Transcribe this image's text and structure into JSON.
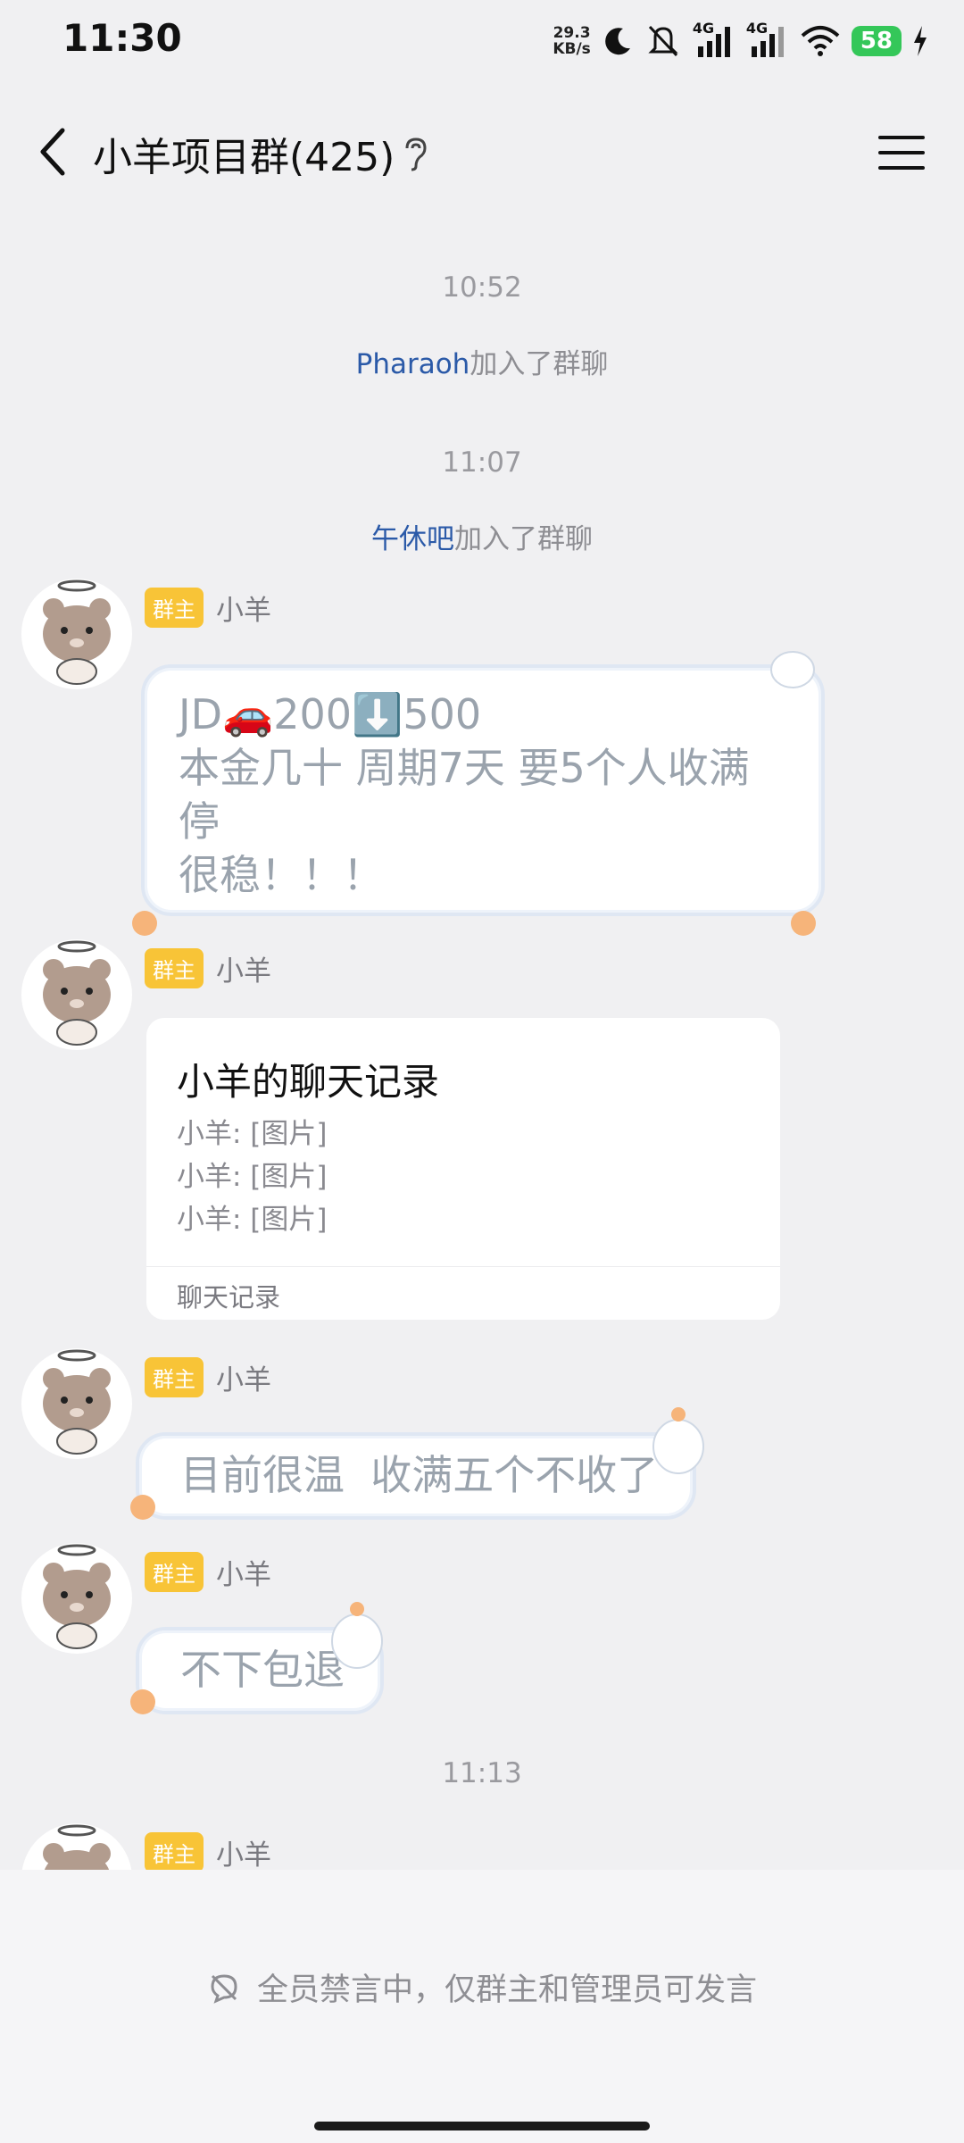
{
  "status_bar": {
    "time": "11:30",
    "net_speed_value": "29.3",
    "net_speed_unit": "KB/s",
    "signal_1": "4G",
    "signal_2": "4G",
    "battery": "58"
  },
  "header": {
    "title": "小羊项目群(425)"
  },
  "timestamps": [
    "10:52",
    "11:07",
    "11:13"
  ],
  "system_notices": [
    {
      "name": "Pharaoh",
      "text": "加入了群聊"
    },
    {
      "name": "午休吧",
      "text": "加入了群聊"
    }
  ],
  "badge_label": "群主",
  "sender_name": "小羊",
  "messages": {
    "m1_lines": [
      "JD🚗200⬇️500",
      "本金几十 周期7天 要5个人收满",
      "停",
      "很稳！！！"
    ],
    "m3_text": "目前很温  收满五个不收了",
    "m4_text": "不下包退"
  },
  "card": {
    "title": "小羊的聊天记录",
    "lines": [
      "小羊: [图片]",
      "小羊: [图片]",
      "小羊: [图片]"
    ],
    "footer": "聊天记录"
  },
  "bottom": {
    "mute_notice": "全员禁言中，仅群主和管理员可发言"
  },
  "colors": {
    "background": "#f0f0f2",
    "badge": "#f8c437",
    "link_name": "#2b5aa8",
    "battery": "#34c759"
  },
  "icons": [
    "back-icon",
    "ear-icon",
    "menu-icon",
    "wifi-icon",
    "moon-icon",
    "mute-icon",
    "charging-icon",
    "no-speak-icon"
  ]
}
